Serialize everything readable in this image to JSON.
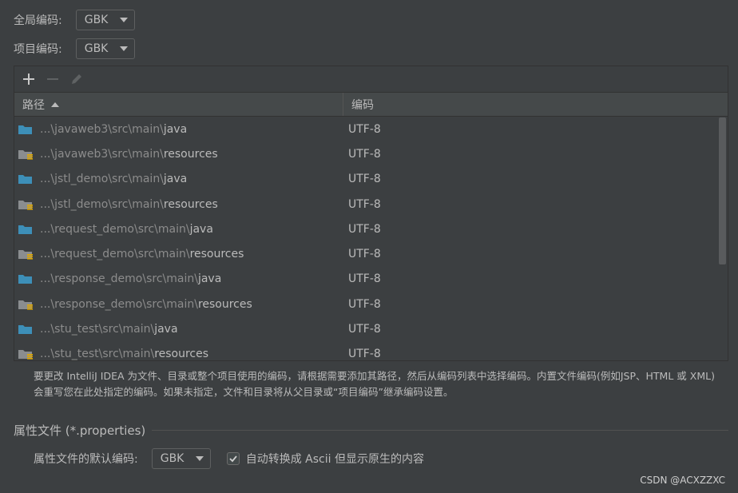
{
  "global_encoding": {
    "label": "全局编码:",
    "value": "GBK"
  },
  "project_encoding": {
    "label": "项目编码:",
    "value": "GBK"
  },
  "toolbar": {
    "add_icon": "+",
    "remove_icon": "−",
    "edit_icon": "pencil-icon"
  },
  "table": {
    "headers": {
      "path": "路径",
      "encoding": "编码"
    },
    "rows": [
      {
        "prefix": "...\\javaweb3\\src\\main\\",
        "leaf": "java",
        "type": "source",
        "encoding": "UTF-8"
      },
      {
        "prefix": "...\\javaweb3\\src\\main\\",
        "leaf": "resources",
        "type": "resources",
        "encoding": "UTF-8"
      },
      {
        "prefix": "...\\jstl_demo\\src\\main\\",
        "leaf": "java",
        "type": "source",
        "encoding": "UTF-8"
      },
      {
        "prefix": "...\\jstl_demo\\src\\main\\",
        "leaf": "resources",
        "type": "resources",
        "encoding": "UTF-8"
      },
      {
        "prefix": "...\\request_demo\\src\\main\\",
        "leaf": "java",
        "type": "source",
        "encoding": "UTF-8"
      },
      {
        "prefix": "...\\request_demo\\src\\main\\",
        "leaf": "resources",
        "type": "resources",
        "encoding": "UTF-8"
      },
      {
        "prefix": "...\\response_demo\\src\\main\\",
        "leaf": "java",
        "type": "source",
        "encoding": "UTF-8"
      },
      {
        "prefix": "...\\response_demo\\src\\main\\",
        "leaf": "resources",
        "type": "resources",
        "encoding": "UTF-8"
      },
      {
        "prefix": "...\\stu_test\\src\\main\\",
        "leaf": "java",
        "type": "source",
        "encoding": "UTF-8"
      },
      {
        "prefix": "...\\stu_test\\src\\main\\",
        "leaf": "resources",
        "type": "resources",
        "encoding": "UTF-8"
      }
    ]
  },
  "help_text": "要更改 IntelliJ IDEA 为文件、目录或整个项目使用的编码，请根据需要添加其路径，然后从编码列表中选择编码。内置文件编码(例如JSP、HTML 或 XML)会重写您在此处指定的编码。如果未指定，文件和目录将从父目录或“项目编码”继承编码设置。",
  "properties": {
    "section_title": "属性文件 (*.properties)",
    "default_label": "属性文件的默认编码:",
    "default_value": "GBK",
    "checkbox_label": "自动转换成 Ascii 但显示原生的内容",
    "checkbox_checked": true
  },
  "watermark": "CSDN @ACXZZXC",
  "colors": {
    "folder_blue": "#3d8fb8",
    "folder_gray": "#8a8d8f",
    "resource_stripe": "#e0a800"
  }
}
